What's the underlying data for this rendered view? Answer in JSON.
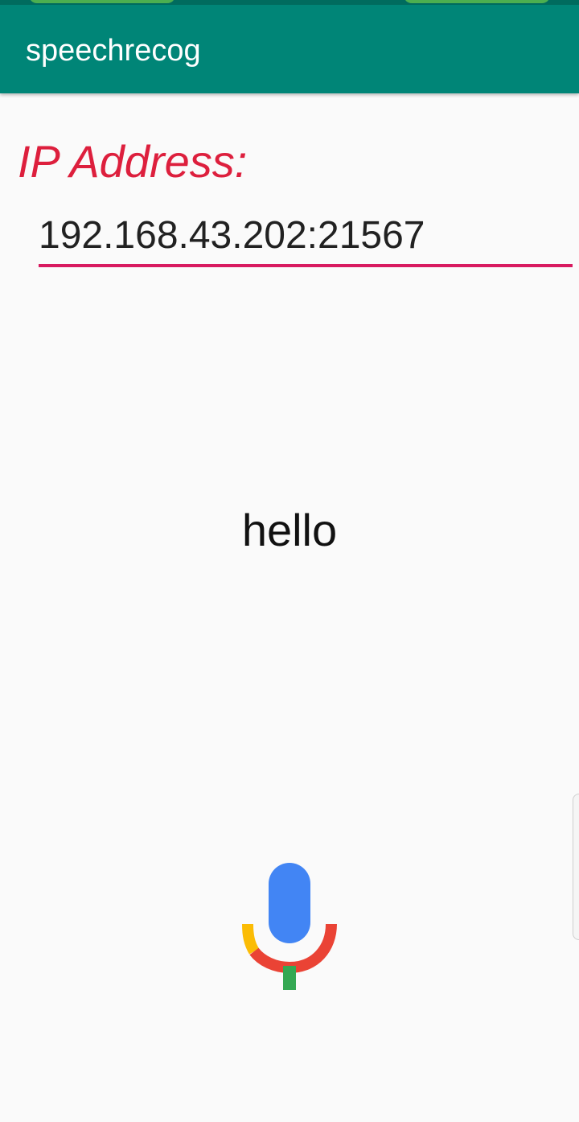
{
  "app_bar": {
    "title": "speechrecog"
  },
  "form": {
    "ip_label": "IP Address:",
    "ip_value": "192.168.43.202:21567"
  },
  "result": {
    "text": "hello"
  },
  "mic": {
    "icon": "google-mic-icon",
    "colors": {
      "capsule": "#4285f4",
      "arc_left": "#fbbc05",
      "arc_main": "#ea4335",
      "stem": "#34a853"
    }
  },
  "theme": {
    "primary": "#008577",
    "status_bar": "#006b5e",
    "label_color": "#dd1f3d",
    "underline_color": "#d81b60",
    "background": "#fafafa"
  }
}
